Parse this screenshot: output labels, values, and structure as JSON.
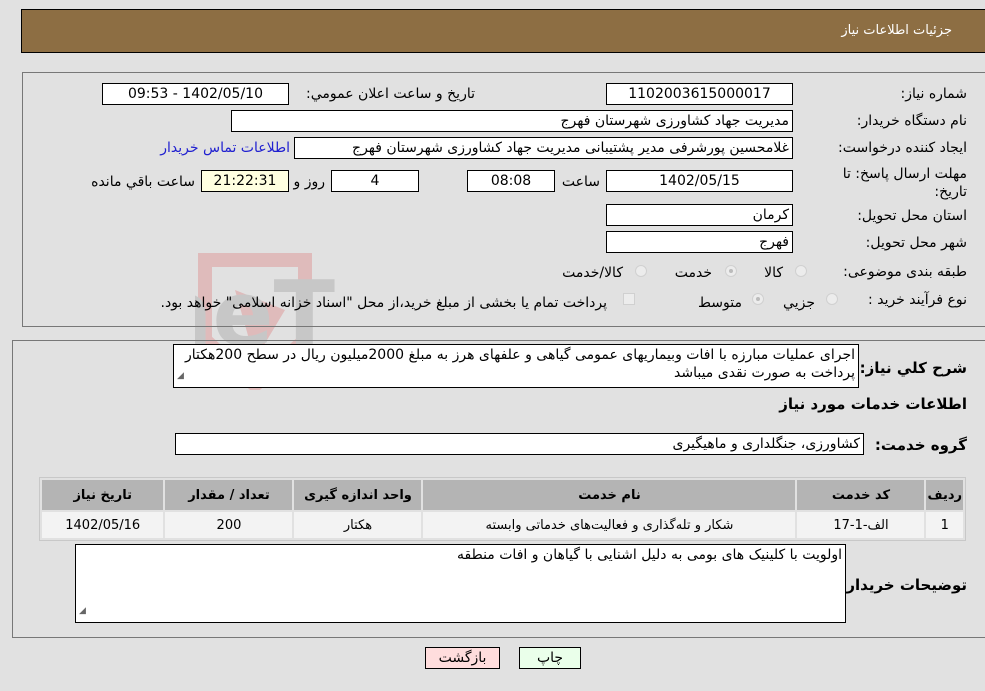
{
  "header": {
    "title": "جزئیات اطلاعات نیاز"
  },
  "details": {
    "need_number_label": "شماره نیاز:",
    "need_number": "1102003615000017",
    "announce_label": "تاريخ و ساعت اعلان عمومي:",
    "announce_value": "1402/05/10 - 09:53",
    "buyer_org_label": "نام دستگاه خريدار:",
    "buyer_org": "مديريت جهاد کشاورزی شهرستان فهرج",
    "creator_label": "ايجاد کننده درخواست:",
    "creator": "غلامحسين پورشرفی مدير پشتيبانی مديريت جهاد کشاورزی شهرستان فهرج",
    "contact_link": "اطلاعات تماس خريدار",
    "deadline_label": "مهلت ارسال پاسخ: تا تاريخ:",
    "deadline_date": "1402/05/15",
    "time_label": "ساعت",
    "deadline_time": "08:08",
    "days_value": "4",
    "days_label": "روز و",
    "remaining_time": "21:22:31",
    "remaining_label": "ساعت باقي مانده",
    "province_label": "استان محل تحويل:",
    "province": "کرمان",
    "city_label": "شهر محل تحويل:",
    "city": "فهرج",
    "category_label": "طبقه بندی موضوعی:",
    "category_options": [
      {
        "label": "کالا",
        "checked": false
      },
      {
        "label": "خدمت",
        "checked": true
      },
      {
        "label": "کالا/خدمت",
        "checked": false
      }
    ],
    "process_label": "نوع فرآيند خريد :",
    "process_options": [
      {
        "label": "جزيي",
        "checked": false
      },
      {
        "label": "متوسط",
        "checked": true
      }
    ],
    "treasury_note": "پرداخت تمام يا بخشی از مبلغ خريد،از محل \"اسناد خزانه اسلامی\" خواهد بود."
  },
  "description": {
    "label": "شرح کلي نياز:",
    "text": "اجرای عملیات مبارزه با افات وبیماریهای عمومی گیاهی و علفهای هرز به مبلغ 2000میلیون ریال در سطح 200هکتار پرداخت به صورت نقدی میباشد"
  },
  "services": {
    "section_title": "اطلاعات خدمات مورد نياز",
    "group_label": "گروه خدمت:",
    "group_value": "کشاورزی، جنگلداری و ماهيگيری",
    "columns": [
      "رديف",
      "کد خدمت",
      "نام خدمت",
      "واحد اندازه گيری",
      "تعداد / مقدار",
      "تاريخ نياز"
    ],
    "rows": [
      [
        "1",
        "الف-1-17",
        "شکار و تله‌گذاری و فعالیت‌های خدماتی وابسته",
        "هکتار",
        "200",
        "1402/05/16"
      ]
    ]
  },
  "buyer_notes": {
    "label": "توضيحات خريدار:",
    "text": "اولویت با کلینیک های بومی به دلیل اشنایی با گیاهان و افات منطقه"
  },
  "buttons": {
    "print": "چاپ",
    "back": "بازگشت"
  },
  "watermark": {
    "text": "AriaTender.neT"
  },
  "colors": {
    "header_bg": "#8d6e43",
    "print_bg": "#eaffea",
    "back_bg": "#ffdddd",
    "link": "#2020d0"
  }
}
